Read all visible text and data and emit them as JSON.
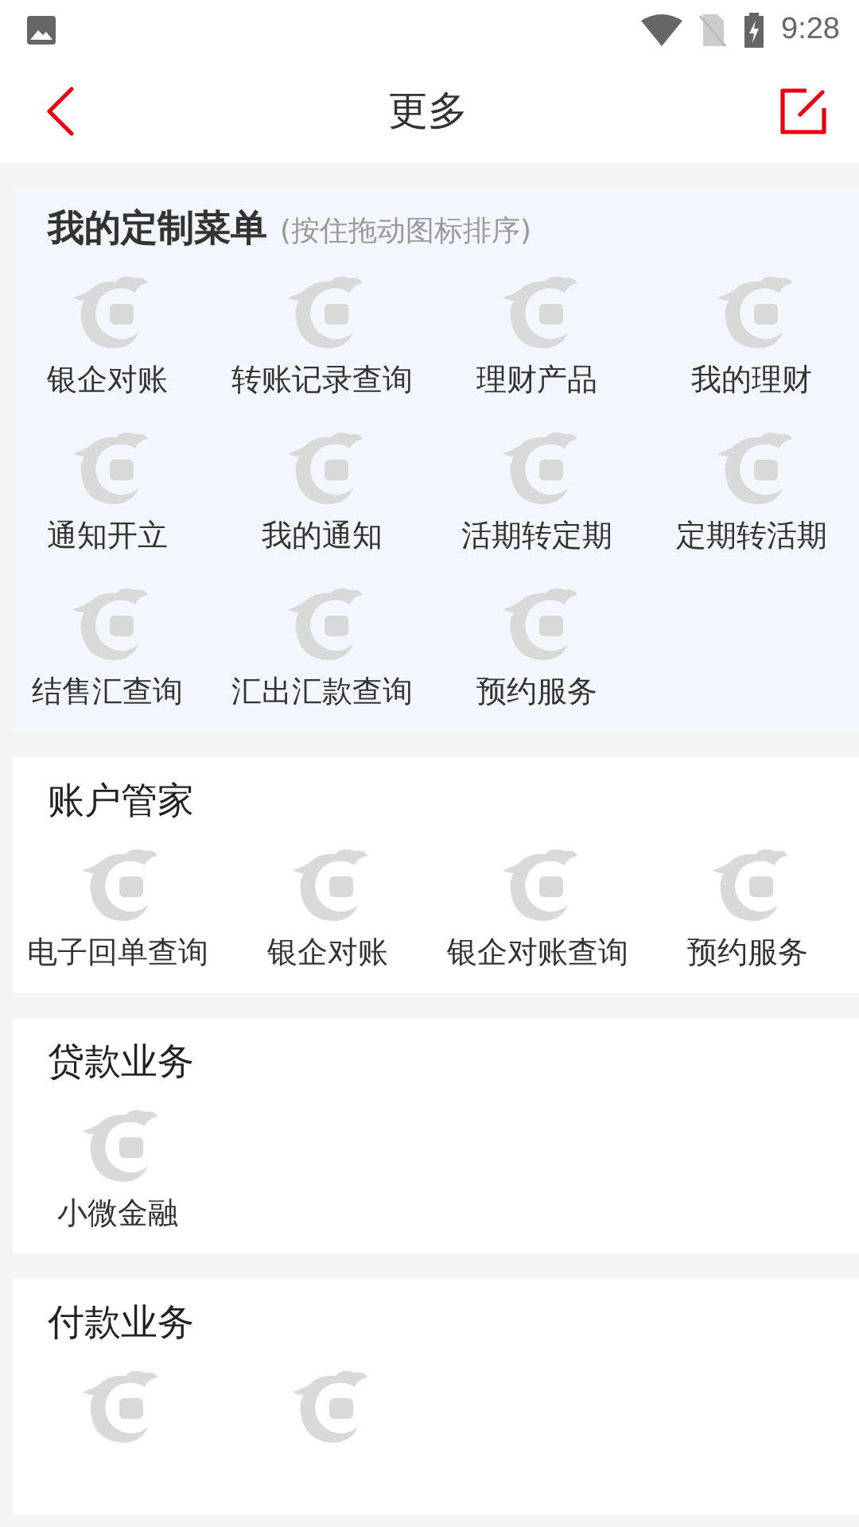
{
  "status_bar": {
    "time": "9:28"
  },
  "header": {
    "title": "更多"
  },
  "sections": [
    {
      "title": "我的定制菜单",
      "hint": "(按住拖动图标排序)",
      "highlighted": true,
      "items": [
        {
          "kind": "labeled",
          "label": "银企对账"
        },
        {
          "kind": "labeled",
          "label": "转账记录查询"
        },
        {
          "kind": "labeled",
          "label": "理财产品"
        },
        {
          "kind": "labeled",
          "label": "我的理财"
        },
        {
          "kind": "labeled",
          "label": "通知开立"
        },
        {
          "kind": "labeled",
          "label": "我的通知"
        },
        {
          "kind": "labeled",
          "label": "活期转定期"
        },
        {
          "kind": "labeled",
          "label": "定期转活期"
        },
        {
          "kind": "labeled",
          "label": "结售汇查询"
        },
        {
          "kind": "labeled",
          "label": "汇出汇款查询"
        },
        {
          "kind": "labeled",
          "label": "预约服务"
        }
      ]
    },
    {
      "title": "账户管家",
      "highlighted": false,
      "items": [
        {
          "kind": "labeled",
          "label": "电子回单查询"
        },
        {
          "kind": "labeled",
          "label": "银企对账"
        },
        {
          "kind": "labeled",
          "label": "银企对账查询"
        },
        {
          "kind": "labeled",
          "label": "预约服务"
        }
      ]
    },
    {
      "title": "贷款业务",
      "highlighted": false,
      "items": [
        {
          "kind": "labeled",
          "label": "小微金融"
        }
      ]
    },
    {
      "title": "付款业务",
      "highlighted": false,
      "items": [
        {
          "kind": "cut"
        },
        {
          "kind": "cut"
        }
      ]
    }
  ]
}
